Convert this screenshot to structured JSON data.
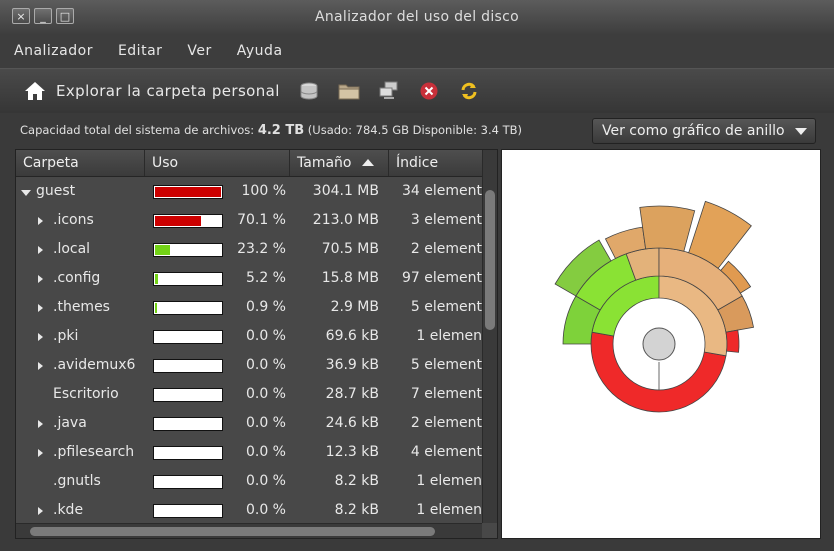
{
  "window": {
    "title": "Analizador del uso del disco",
    "controls": [
      "×",
      "_",
      "□"
    ]
  },
  "menu": [
    "Analizador",
    "Editar",
    "Ver",
    "Ayuda"
  ],
  "toolbar": {
    "home_label": "Explorar la carpeta personal",
    "icons": [
      "home-icon",
      "disk-icon",
      "folder-icon",
      "network-icon",
      "stop-icon",
      "refresh-icon"
    ]
  },
  "info": {
    "prefix": "Capacidad total del sistema de archivos: ",
    "total": "4.2 TB",
    "used_label": " (Usado: ",
    "used": "784.5 GB",
    "free_label": " Disponible: ",
    "free": "3.4 TB)"
  },
  "view_select": {
    "label": "Ver como gráfico de anillo"
  },
  "columns": [
    "Carpeta",
    "Uso",
    "Tamaño",
    "Índice"
  ],
  "colors": {
    "red": "#cc0000",
    "green": "#73d216",
    "chart_red": "#ef2929",
    "chart_tan": "#e0a86a",
    "chart_green": "#8ae234"
  },
  "rows": [
    {
      "name": "guest",
      "level": 0,
      "expander": "open",
      "usage_pct": 100,
      "usage": "100 %",
      "size": "304.1 MB",
      "index": "34 element",
      "bar_color": "#cc0000"
    },
    {
      "name": ".icons",
      "level": 1,
      "expander": "closed",
      "usage_pct": 70.1,
      "usage": "70.1 %",
      "size": "213.0 MB",
      "index": "3 element",
      "bar_color": "#cc0000"
    },
    {
      "name": ".local",
      "level": 1,
      "expander": "closed",
      "usage_pct": 23.2,
      "usage": "23.2 %",
      "size": "70.5 MB",
      "index": "2 element",
      "bar_color": "#73d216"
    },
    {
      "name": ".config",
      "level": 1,
      "expander": "closed",
      "usage_pct": 5.2,
      "usage": "5.2 %",
      "size": "15.8 MB",
      "index": "97 element",
      "bar_color": "#73d216"
    },
    {
      "name": ".themes",
      "level": 1,
      "expander": "closed",
      "usage_pct": 0.9,
      "usage": "0.9 %",
      "size": "2.9 MB",
      "index": "5 element",
      "bar_color": "#73d216"
    },
    {
      "name": ".pki",
      "level": 1,
      "expander": "closed",
      "usage_pct": 0,
      "usage": "0.0 %",
      "size": "69.6 kB",
      "index": "1 elemen",
      "bar_color": "#73d216"
    },
    {
      "name": ".avidemux6",
      "level": 1,
      "expander": "closed",
      "usage_pct": 0,
      "usage": "0.0 %",
      "size": "36.9 kB",
      "index": "5 element",
      "bar_color": "#73d216"
    },
    {
      "name": "Escritorio",
      "level": 1,
      "expander": "none",
      "usage_pct": 0,
      "usage": "0.0 %",
      "size": "28.7 kB",
      "index": "7 element",
      "bar_color": "#73d216"
    },
    {
      "name": ".java",
      "level": 1,
      "expander": "closed",
      "usage_pct": 0,
      "usage": "0.0 %",
      "size": "24.6 kB",
      "index": "2 element",
      "bar_color": "#73d216"
    },
    {
      "name": ".pfilesearch",
      "level": 1,
      "expander": "closed",
      "usage_pct": 0,
      "usage": "0.0 %",
      "size": "12.3 kB",
      "index": "4 element",
      "bar_color": "#73d216"
    },
    {
      "name": ".gnutls",
      "level": 1,
      "expander": "none",
      "usage_pct": 0,
      "usage": "0.0 %",
      "size": "8.2 kB",
      "index": "1 elemen",
      "bar_color": "#73d216"
    },
    {
      "name": ".kde",
      "level": 1,
      "expander": "closed",
      "usage_pct": 0,
      "usage": "0.0 %",
      "size": "8.2 kB",
      "index": "1 elemen",
      "bar_color": "#73d216"
    }
  ]
}
